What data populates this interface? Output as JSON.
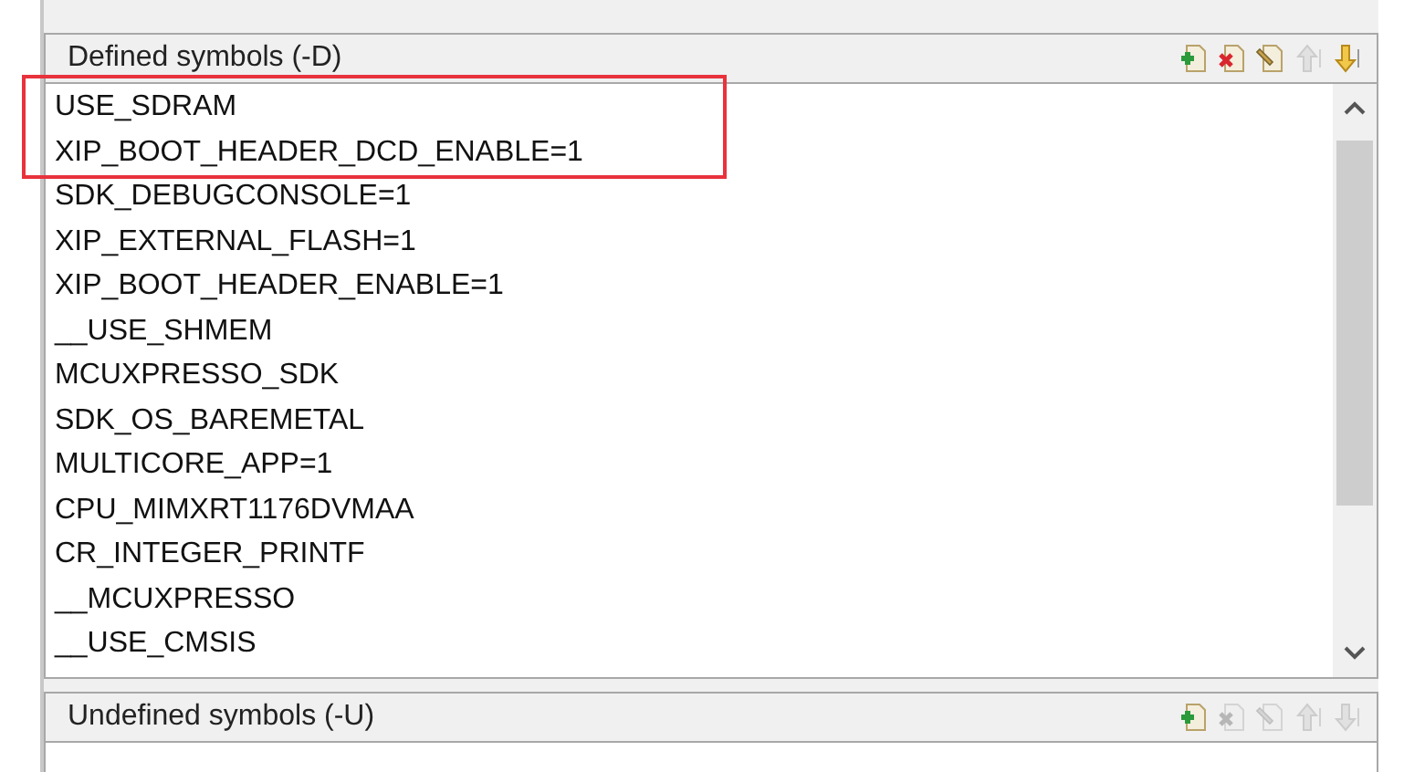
{
  "panels": [
    {
      "title": "Defined symbols (-D)",
      "tools": [
        {
          "kind": "add",
          "disabled": false
        },
        {
          "kind": "delete",
          "disabled": false
        },
        {
          "kind": "edit",
          "disabled": false
        },
        {
          "kind": "up",
          "disabled": true
        },
        {
          "kind": "down",
          "disabled": false
        }
      ],
      "items": [
        "USE_SDRAM",
        "XIP_BOOT_HEADER_DCD_ENABLE=1",
        "SDK_DEBUGCONSOLE=1",
        "XIP_EXTERNAL_FLASH=1",
        "XIP_BOOT_HEADER_ENABLE=1",
        "__USE_SHMEM",
        "MCUXPRESSO_SDK",
        "SDK_OS_BAREMETAL",
        "MULTICORE_APP=1",
        "CPU_MIMXRT1176DVMAA",
        "CR_INTEGER_PRINTF",
        "__MCUXPRESSO",
        "__USE_CMSIS"
      ],
      "scrollbar": true
    },
    {
      "title": "Undefined symbols (-U)",
      "tools": [
        {
          "kind": "add",
          "disabled": false
        },
        {
          "kind": "delete",
          "disabled": true
        },
        {
          "kind": "edit",
          "disabled": true
        },
        {
          "kind": "up",
          "disabled": true
        },
        {
          "kind": "down",
          "disabled": true
        }
      ],
      "scrollbar": false
    }
  ],
  "annotation": {
    "kind": "highlight",
    "color": "#e8323c"
  }
}
